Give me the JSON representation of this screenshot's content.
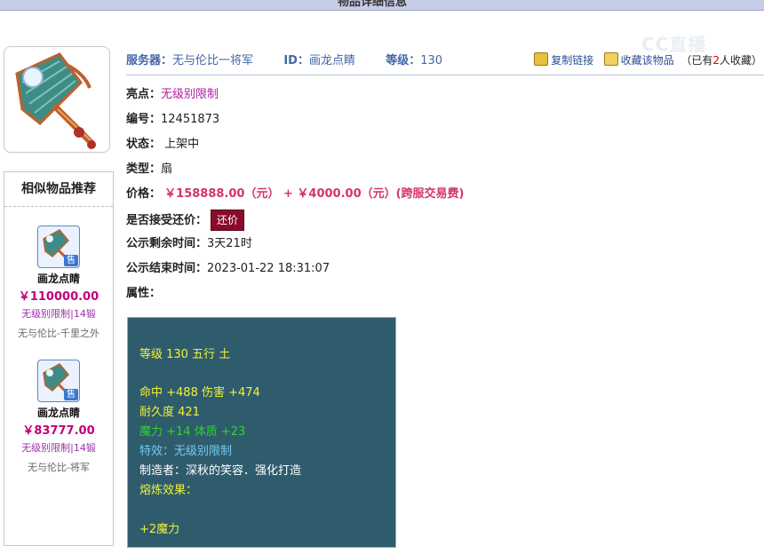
{
  "page_title": "物品详细信息",
  "watermark": "CC直播",
  "item": {
    "server_label": "服务器：",
    "server_value": "无与伦比一将军",
    "id_label": "ID：",
    "id_value": "画龙点睛",
    "level_label": "等级：",
    "level_value": "130",
    "copy_link": "复制链接",
    "favorite": "收藏该物品",
    "fav_count_prefix": "（已有",
    "fav_count": "2",
    "fav_count_suffix": "人收藏）"
  },
  "details": {
    "highlight_label": "亮点：",
    "highlight_value": "无级别限制",
    "number_label": "编号：",
    "number_value": "12451873",
    "status_label": "状态：",
    "status_value": "上架中",
    "type_label": "类型：",
    "type_value": "扇",
    "price_label": "价格：",
    "price_value": "￥158888.00（元） +  ￥4000.00（元）(跨服交易费)",
    "bargain_label": "是否接受还价：",
    "bargain_button": "还价",
    "remaining_label": "公示剩余时间：",
    "remaining_value": "3天21时",
    "end_label": "公示结束时间：",
    "end_value": "2023-01-22 18:31:07",
    "attributes_label": "属性："
  },
  "attributes": {
    "line1": "等级 130 五行 土",
    "line2": "命中 +488 伤害 +474",
    "line3": "耐久度 421",
    "line4": "魔力 +14 体质 +23",
    "line5": "特效：无级别限制",
    "line6": "制造者：深秋的笑容．强化打造",
    "line7": "熔炼效果：",
    "line8": "+2魔力"
  },
  "similar": {
    "title": "相似物品推荐",
    "items": [
      {
        "tag": "售",
        "name": "画龙点睛",
        "price": "￥110000.00",
        "desc": "无级别限制|14锻",
        "server": "无与伦比-千里之外"
      },
      {
        "tag": "售",
        "name": "画龙点睛",
        "price": "￥83777.00",
        "desc": "无级别限制|14锻",
        "server": "无与伦比-将军"
      }
    ]
  },
  "colors": {
    "accent": "#4266a8",
    "price": "#d4336a",
    "attr_bg": "#2f5c6c",
    "bargain_bg": "#8a0a2a"
  }
}
